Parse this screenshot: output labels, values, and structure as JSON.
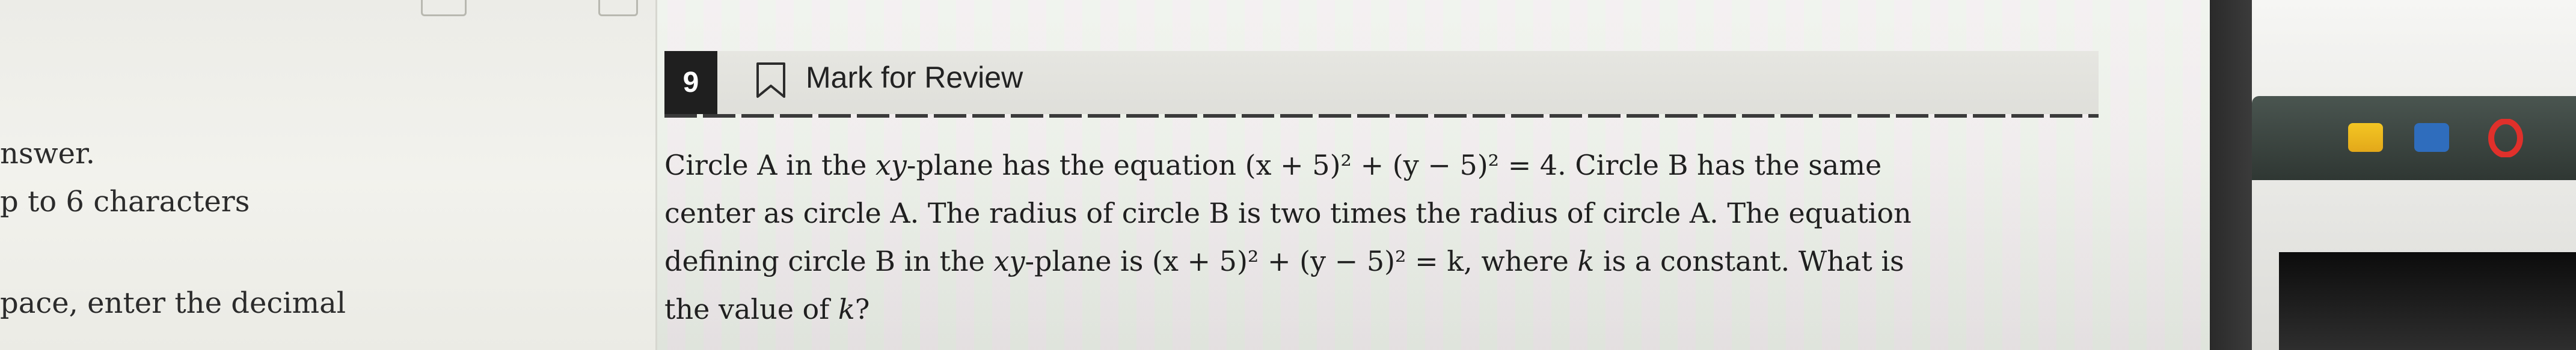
{
  "left_panel": {
    "lines": [
      "nswer.",
      "p to 6 characters",
      "pace, enter the decimal"
    ]
  },
  "question": {
    "number": "9",
    "mark_for_review_label": "Mark for Review",
    "lines": [
      {
        "pre": "Circle A in the ",
        "var1": "xy",
        "mid": "-plane has the equation ",
        "eq": "(x + 5)² + (y − 5)² = 4",
        "post": ". Circle B has the same"
      },
      {
        "text": "center as circle A. The radius of circle B is two times the radius of circle A. The equation"
      },
      {
        "pre": "defining circle B in the ",
        "var1": "xy",
        "mid": "-plane is ",
        "eq": "(x + 5)² + (y − 5)² = k",
        "post": ", where ",
        "var2": "k",
        "post2": " is a constant. What is"
      },
      {
        "pre": "the value of ",
        "var1": "k",
        "post": "?"
      }
    ]
  },
  "icons": {
    "bookmark": "bookmark-icon",
    "taskbar": [
      "notes-app-icon",
      "store-app-icon",
      "opera-browser-icon"
    ]
  },
  "colors": {
    "question_number_bg": "#1f1f1f",
    "text": "#1f1f1f",
    "opera_red": "#e0302b"
  }
}
